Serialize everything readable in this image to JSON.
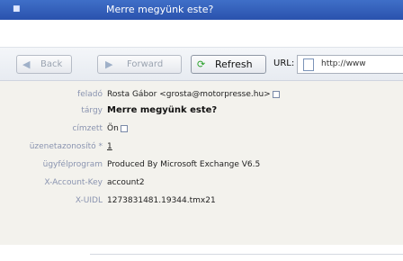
{
  "window": {
    "title": "Merre megyünk este?"
  },
  "toolbar": {
    "back_label": "Back",
    "forward_label": "Forward",
    "refresh_label": "Refresh",
    "url_label": "URL:",
    "url_value": "http://www"
  },
  "headers": {
    "rows": [
      {
        "key": "feladó",
        "value": "Rosta Gábor <grosta@motorpresse.hu>"
      },
      {
        "key": "tárgy",
        "value": "Merre megyünk este?"
      },
      {
        "key": "címzett",
        "value": "Ön"
      },
      {
        "key": "üzenetazonosító *",
        "value": "1"
      },
      {
        "key": "ügyfélprogram",
        "value": "Produced By Microsoft Exchange V6.5"
      },
      {
        "key": "X-Account-Key",
        "value": "account2"
      },
      {
        "key": "X-UIDL",
        "value": "1273831481.19344.tmx21"
      }
    ]
  },
  "colors": {
    "titlebar": "#2a52ad",
    "header_key": "#8a94b0",
    "header_background": "#f3f2ed",
    "refresh_icon": "#2aa02a"
  }
}
